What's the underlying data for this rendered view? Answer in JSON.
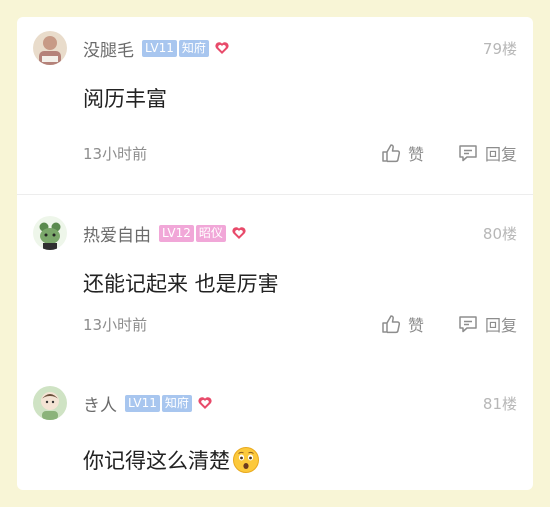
{
  "comments": [
    {
      "username": "没腿毛",
      "level": "LV11",
      "title": "知府",
      "floor": "79楼",
      "content": "阅历丰富",
      "time": "13小时前",
      "like_label": "赞",
      "reply_label": "回复",
      "badge_color": "#a8c6ef"
    },
    {
      "username": "热爱自由",
      "level": "LV12",
      "title": "昭仪",
      "floor": "80楼",
      "content": "还能记起来 也是厉害",
      "time": "13小时前",
      "like_label": "赞",
      "reply_label": "回复",
      "badge_color": "#f1a7d8"
    },
    {
      "username": "き人",
      "level": "LV11",
      "title": "知府",
      "floor": "81楼",
      "content": "你记得这么清楚",
      "content_emoji": "astonished-face-emoji",
      "badge_color": "#a8c6ef"
    }
  ],
  "colors": {
    "background": "#f8f5d6",
    "heart": "#e84a6a"
  }
}
